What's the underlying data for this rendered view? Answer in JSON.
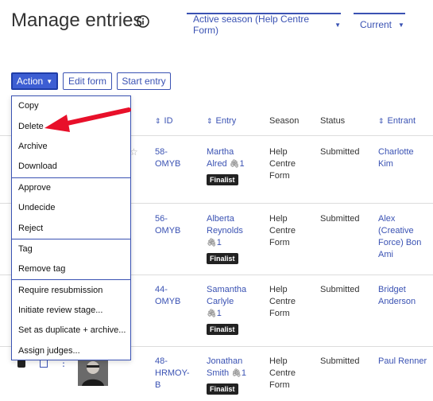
{
  "header": {
    "title": "Manage entries",
    "season_filter": "Active season (Help Centre Form)",
    "status_filter": "Current"
  },
  "toolbar": {
    "action_label": "Action",
    "edit_form_label": "Edit form",
    "start_entry_label": "Start entry"
  },
  "columns": {
    "id": "ID",
    "entry": "Entry",
    "season": "Season",
    "status": "Status",
    "entrant": "Entrant"
  },
  "action_menu": {
    "items": [
      "Copy",
      "Delete",
      "Archive",
      "Download",
      "Approve",
      "Undecide",
      "Reject",
      "Tag",
      "Remove tag",
      "Require resubmission",
      "Initiate review stage...",
      "Set as duplicate + archive...",
      "Assign judges..."
    ]
  },
  "rows": [
    {
      "id": [
        "58-",
        "OMYB"
      ],
      "entry": [
        "Martha",
        "Alred"
      ],
      "attachments": "1",
      "badge": "Finalist",
      "season": [
        "Help",
        "Centre",
        "Form"
      ],
      "status": "Submitted",
      "entrant": [
        "Charlotte",
        "Kim"
      ]
    },
    {
      "id": [
        "56-",
        "OMYB"
      ],
      "entry": [
        "Alberta",
        "Reynolds"
      ],
      "attachments": "1",
      "badge": "Finalist",
      "season": [
        "Help",
        "Centre",
        "Form"
      ],
      "status": "Submitted",
      "entrant": [
        "Alex",
        "(Creative",
        "Force) Bon",
        "Ami"
      ]
    },
    {
      "id": [
        "44-",
        "OMYB"
      ],
      "entry": [
        "Samantha",
        "Carlyle"
      ],
      "attachments": "1",
      "badge": "Finalist",
      "season": [
        "Help",
        "Centre",
        "Form"
      ],
      "status": "Submitted",
      "entrant": [
        "Bridget",
        "Anderson"
      ]
    },
    {
      "id": [
        "48-",
        "HRMOY-",
        "B"
      ],
      "entry": [
        "Jonathan",
        "Smith"
      ],
      "attachments": "1",
      "badge": "Finalist",
      "season": [
        "Help",
        "Centre",
        "Form"
      ],
      "status": "Submitted",
      "entrant": [
        "Paul Renner"
      ]
    }
  ],
  "colors": {
    "accent": "#3a52b3",
    "action_button": "#3d5ed3",
    "arrow": "#e8102a",
    "badge": "#222222"
  },
  "icons": [
    "info-icon",
    "caret-down-icon",
    "sort-icon",
    "paperclip-icon",
    "star-icon",
    "red-arrow-annotation"
  ]
}
